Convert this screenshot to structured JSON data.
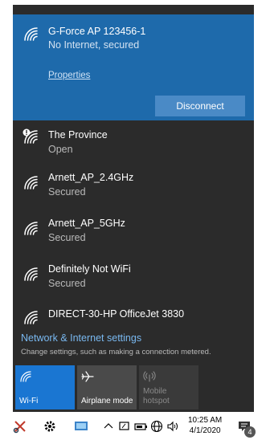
{
  "connected_network": {
    "name": "G-Force AP 123456-1",
    "status": "No Internet, secured",
    "properties_label": "Properties",
    "disconnect_label": "Disconnect",
    "icon": "wifi-signal-icon"
  },
  "networks": [
    {
      "name": "The Province",
      "status": "Open",
      "icon": "wifi-open-warning-icon"
    },
    {
      "name": "Arnett_AP_2.4GHz",
      "status": "Secured",
      "icon": "wifi-signal-icon"
    },
    {
      "name": "Arnett_AP_5GHz",
      "status": "Secured",
      "icon": "wifi-signal-icon"
    },
    {
      "name": "Definitely Not WiFi",
      "status": "Secured",
      "icon": "wifi-signal-icon"
    },
    {
      "name": "DIRECT-30-HP OfficeJet 3830",
      "status": "",
      "icon": "wifi-signal-icon"
    }
  ],
  "settings": {
    "link": "Network & Internet settings",
    "description": "Change settings, such as making a connection metered."
  },
  "quick_actions": [
    {
      "label": "Wi-Fi",
      "state": "on",
      "icon": "wifi-icon"
    },
    {
      "label": "Airplane mode",
      "state": "off",
      "icon": "airplane-icon"
    },
    {
      "label": "Mobile hotspot",
      "state": "disabled",
      "icon": "hotspot-icon"
    }
  ],
  "taskbar": {
    "time": "10:25 AM",
    "date": "4/1/2020",
    "notification_count": "4"
  },
  "colors": {
    "flyout_bg": "#2b2b2b",
    "connected_bg": "#1e6aab",
    "accent": "#1a76d2",
    "link": "#79b8f0"
  }
}
